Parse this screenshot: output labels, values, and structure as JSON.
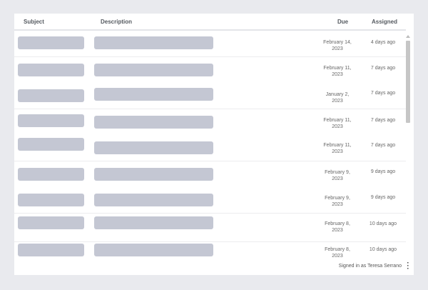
{
  "table": {
    "columns": {
      "subject": "Subject",
      "description": "Description",
      "due": "Due",
      "assigned": "Assigned"
    },
    "rows": [
      {
        "due_line1": "February 14,",
        "due_line2": "2023",
        "assigned": "4 days ago"
      },
      {
        "due_line1": "February 11,",
        "due_line2": "2023",
        "assigned": "7 days ago"
      },
      {
        "due_line1": "January 2,",
        "due_line2": "2023",
        "assigned": "7 days ago"
      },
      {
        "due_line1": "February 11,",
        "due_line2": "2023",
        "assigned": "7 days ago"
      },
      {
        "due_line1": "February 11,",
        "due_line2": "2023",
        "assigned": "7 days ago"
      },
      {
        "due_line1": "February 9,",
        "due_line2": "2023",
        "assigned": "9 days ago"
      },
      {
        "due_line1": "February 9,",
        "due_line2": "2023",
        "assigned": "9 days ago"
      },
      {
        "due_line1": "February 8,",
        "due_line2": "2023",
        "assigned": "10 days ago"
      },
      {
        "due_line1": "February 8,",
        "due_line2": "2023",
        "assigned": "10 days ago"
      }
    ]
  },
  "footer": {
    "signed_in": "Signed in as Teresa Serrano",
    "menu_icon": "kebab-menu-icon"
  },
  "colors": {
    "background": "#e9eaee",
    "panel": "#ffffff",
    "placeholder": "#c4c7d3"
  }
}
